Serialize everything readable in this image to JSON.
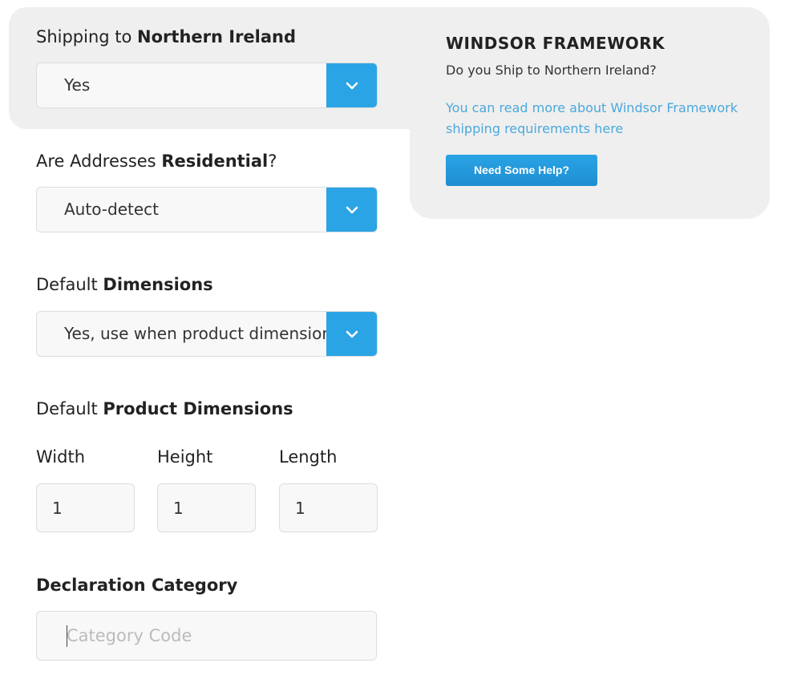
{
  "shipping_northern_ireland": {
    "label_prefix": "Shipping to ",
    "label_bold": "Northern Ireland",
    "value": "Yes"
  },
  "residential": {
    "label_prefix": "Are Addresses ",
    "label_bold": "Residential",
    "label_suffix": "?",
    "value": "Auto-detect"
  },
  "default_dimensions": {
    "label_prefix": "Default ",
    "label_bold": "Dimensions",
    "value": "Yes, use when product dimensions are not set"
  },
  "product_dimensions": {
    "label_prefix": "Default ",
    "label_bold": "Product Dimensions",
    "width_label": "Width",
    "width_value": "1",
    "height_label": "Height",
    "height_value": "1",
    "length_label": "Length",
    "length_value": "1"
  },
  "declaration_category": {
    "label": "Declaration Category",
    "placeholder": "Category Code"
  },
  "info_panel": {
    "title": "WINDSOR FRAMEWORK",
    "question": "Do you Ship to Northern Ireland?",
    "link_text": "You can read more about Windsor Framework shipping requirements here",
    "help_button": "Need Some Help?"
  },
  "colors": {
    "accent": "#2ba4e6",
    "link": "#4aa8dc",
    "panel_bg": "#efefef"
  },
  "icons": {
    "select_arrow": "chevron-down-icon"
  }
}
